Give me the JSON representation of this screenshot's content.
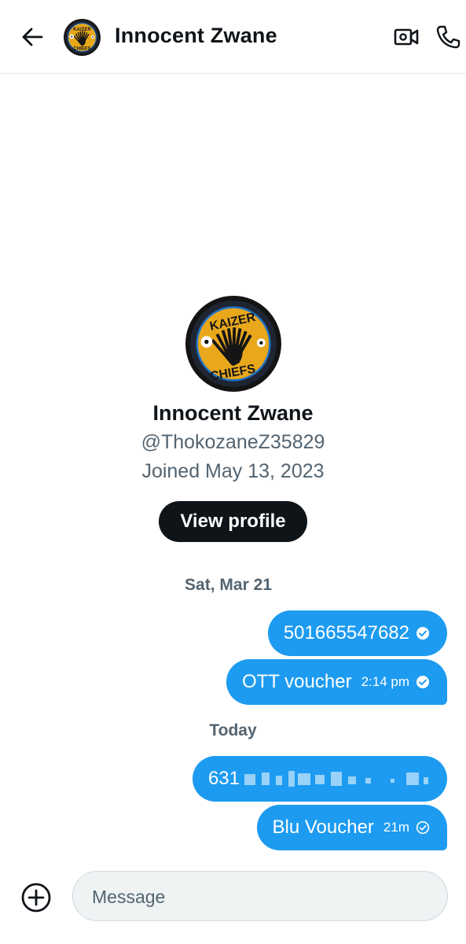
{
  "header": {
    "title": "Innocent Zwane",
    "back_icon": "arrow-left-icon",
    "video_icon": "video-call-icon",
    "phone_icon": "phone-icon"
  },
  "profile": {
    "name": "Innocent Zwane",
    "handle": "@ThokozaneZ35829",
    "joined": "Joined May 13, 2023",
    "view_profile_label": "View profile",
    "avatar_logo_text": [
      "KAIZER",
      "CHIEFS"
    ]
  },
  "conversation": {
    "groups": [
      {
        "date": "Sat, Mar 21",
        "messages": [
          {
            "text": "501665547682",
            "time": "",
            "status": "read"
          },
          {
            "text": "OTT voucher",
            "time": "2:14 pm",
            "status": "read"
          }
        ]
      },
      {
        "date": "Today",
        "messages": [
          {
            "text": "631",
            "time": "",
            "status": "redacted"
          },
          {
            "text": "Blu Voucher",
            "time": "21m",
            "status": "sent"
          }
        ]
      }
    ]
  },
  "composer": {
    "placeholder": "Message",
    "add_icon": "plus-circle-icon"
  },
  "colors": {
    "accent": "#1d9bf0",
    "text": "#0f1419",
    "secondary_text": "#536471",
    "button_dark": "#0f1419",
    "logo_gold": "#f0b323"
  }
}
